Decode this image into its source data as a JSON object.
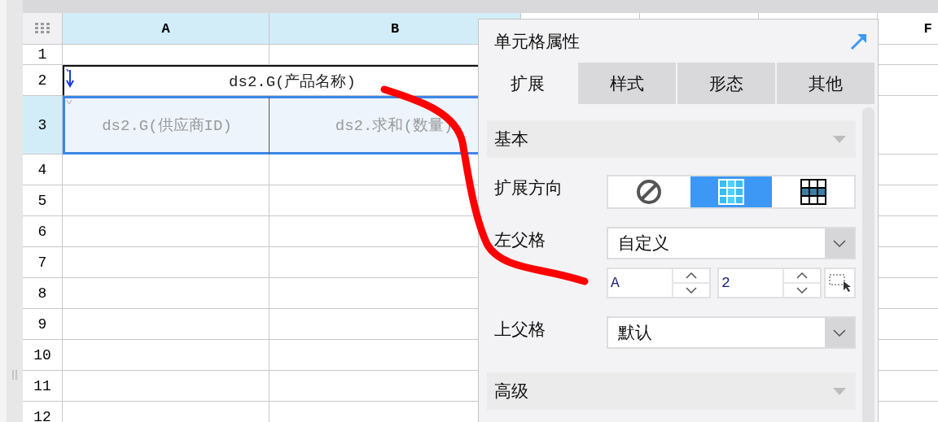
{
  "sheet": {
    "columns": [
      {
        "label": "A",
        "selected": true
      },
      {
        "label": "B",
        "selected": true
      },
      {
        "selected": false
      },
      {
        "selected": false
      },
      {
        "selected": false
      },
      {
        "label": "F",
        "selected": false
      }
    ],
    "rows": [
      {
        "label": "1",
        "selected": false
      },
      {
        "label": "2",
        "selected": false,
        "cells": [
          {
            "kind": "expanding-merged",
            "text": "ds2.G(产品名称)"
          }
        ]
      },
      {
        "label": "3",
        "selected": true,
        "cells": [
          {
            "kind": "grouped",
            "text": "ds2.G(供应商ID)"
          },
          {
            "kind": "summary",
            "text": "ds2.求和(数量)"
          }
        ]
      },
      {
        "label": "4",
        "selected": false
      },
      {
        "label": "5",
        "selected": false
      },
      {
        "label": "6",
        "selected": false
      },
      {
        "label": "7",
        "selected": false
      },
      {
        "label": "8",
        "selected": false
      },
      {
        "label": "9",
        "selected": false
      },
      {
        "label": "10",
        "selected": false
      },
      {
        "label": "11",
        "selected": false
      },
      {
        "label": "12",
        "selected": false
      }
    ]
  },
  "panel": {
    "title": "单元格属性",
    "tabs": [
      {
        "label": "扩展",
        "selected": true
      },
      {
        "label": "样式",
        "selected": false
      },
      {
        "label": "形态",
        "selected": false
      },
      {
        "label": "其他",
        "selected": false
      }
    ],
    "sections": [
      {
        "title": "基本",
        "fields": [
          {
            "kind": "segmented",
            "label": "扩展方向",
            "options": [
              {
                "kind": "none",
                "selected": false
              },
              {
                "kind": "vertical",
                "selected": true
              },
              {
                "kind": "horizontal",
                "selected": false
              }
            ]
          },
          {
            "kind": "select",
            "label": "左父格",
            "value": "自定义",
            "custom": {
              "column": "A",
              "row": "2"
            }
          },
          {
            "kind": "select",
            "label": "上父格",
            "value": "默认"
          }
        ]
      },
      {
        "title": "高级"
      }
    ]
  }
}
